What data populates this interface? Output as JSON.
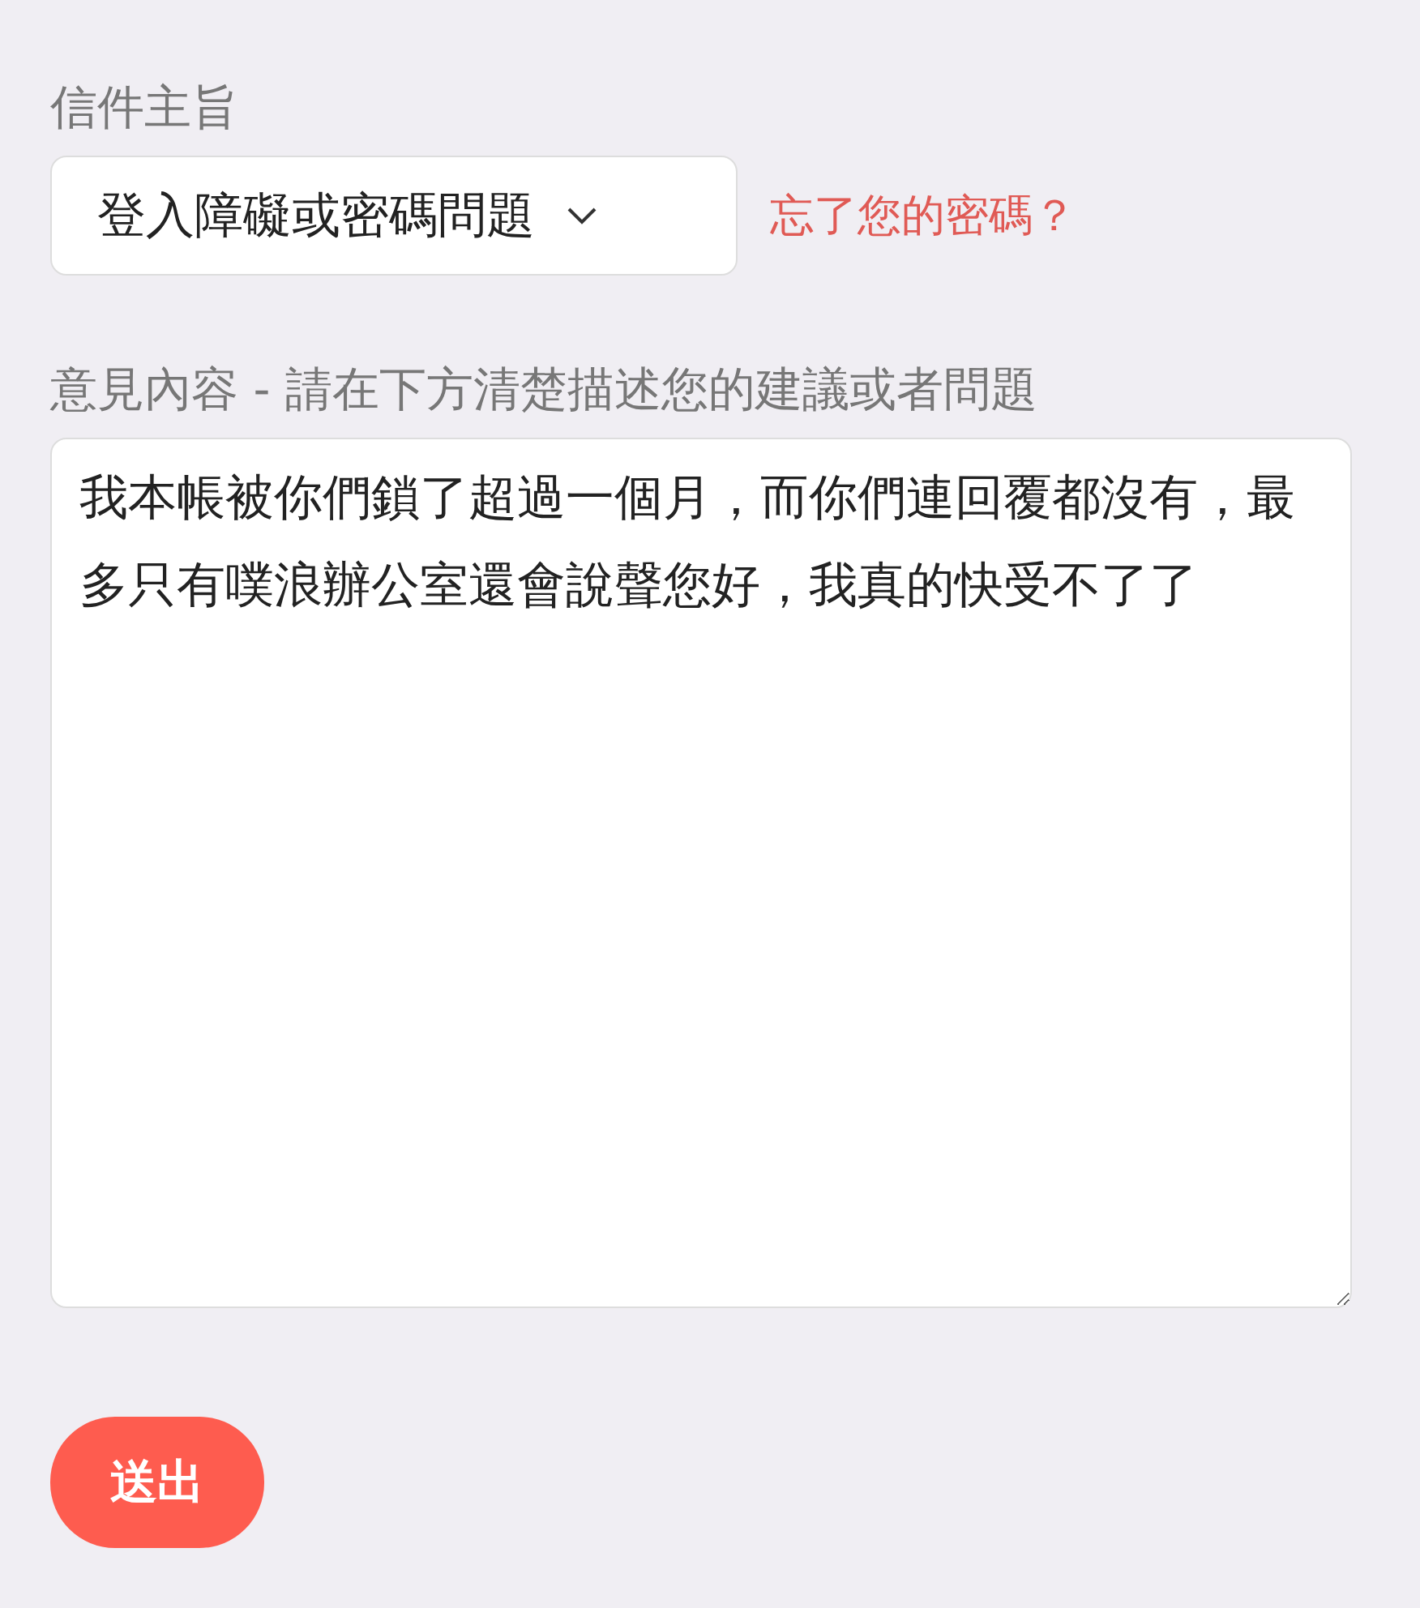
{
  "subject": {
    "label": "信件主旨",
    "value": "登入障礙或密碼問題",
    "link": "忘了您的密碼？"
  },
  "content": {
    "label": "意見內容 - 請在下方清楚描述您的建議或者問題",
    "value": "我本帳被你們鎖了超過一個月，而你們連回覆都沒有，最多只有噗浪辦公室還會說聲您好，我真的快受不了了"
  },
  "submit": "送出"
}
